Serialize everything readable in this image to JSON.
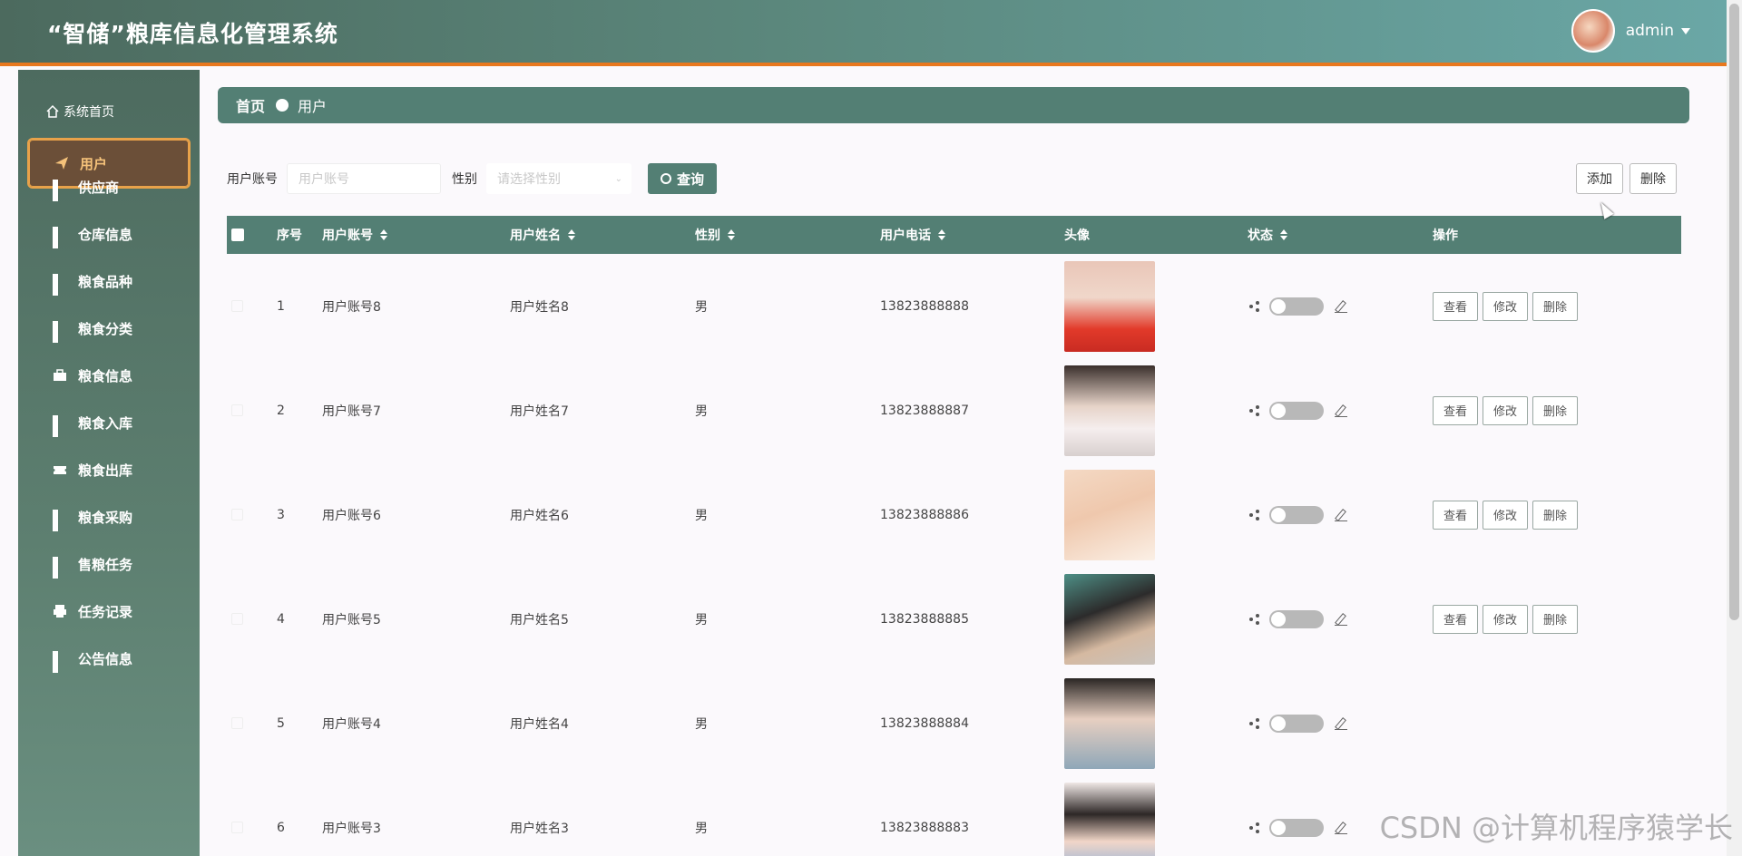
{
  "header": {
    "title": "“智储”粮库信息化管理系统",
    "user_name": "admin"
  },
  "sidebar": {
    "home": "系统首页",
    "items": [
      {
        "label": "用户",
        "active": true,
        "icon": "paper-plane-icon"
      },
      {
        "label": "供应商",
        "icon": "grid-icon"
      },
      {
        "label": "仓库信息",
        "icon": "grid-icon"
      },
      {
        "label": "粮食品种",
        "icon": "grid-icon"
      },
      {
        "label": "粮食分类",
        "icon": "grid-icon"
      },
      {
        "label": "粮食信息",
        "icon": "briefcase-icon"
      },
      {
        "label": "粮食入库",
        "icon": "grid-icon"
      },
      {
        "label": "粮食出库",
        "icon": "ticket-icon"
      },
      {
        "label": "粮食采购",
        "icon": "grid-icon"
      },
      {
        "label": "售粮任务",
        "icon": "grid-icon"
      },
      {
        "label": "任务记录",
        "icon": "printer-icon"
      },
      {
        "label": "公告信息",
        "icon": "grid-icon"
      }
    ]
  },
  "breadcrumb": {
    "home": "首页",
    "current": "用户"
  },
  "search": {
    "account_label": "用户账号",
    "account_placeholder": "用户账号",
    "gender_label": "性别",
    "gender_placeholder": "请选择性别",
    "query_button": "查询"
  },
  "toolbar": {
    "add_button": "添加",
    "delete_button": "删除"
  },
  "table": {
    "columns": [
      "序号",
      "用户账号",
      "用户姓名",
      "性别",
      "用户电话",
      "头像",
      "状态",
      "操作"
    ],
    "actions": [
      "查看",
      "修改",
      "删除"
    ],
    "rows": [
      {
        "index": "1",
        "account": "用户账号8",
        "name": "用户姓名8",
        "gender": "男",
        "phone": "13823888888"
      },
      {
        "index": "2",
        "account": "用户账号7",
        "name": "用户姓名7",
        "gender": "男",
        "phone": "13823888887"
      },
      {
        "index": "3",
        "account": "用户账号6",
        "name": "用户姓名6",
        "gender": "男",
        "phone": "13823888886"
      },
      {
        "index": "4",
        "account": "用户账号5",
        "name": "用户姓名5",
        "gender": "男",
        "phone": "13823888885"
      },
      {
        "index": "5",
        "account": "用户账号4",
        "name": "用户姓名4",
        "gender": "男",
        "phone": "13823888884"
      },
      {
        "index": "6",
        "account": "用户账号3",
        "name": "用户姓名3",
        "gender": "男",
        "phone": "13823888883"
      }
    ]
  },
  "watermark": "CSDN @计算机程序猿学长",
  "colors": {
    "primary": "#537f74",
    "accent": "#e8781e",
    "active_border": "#e8a24a"
  }
}
